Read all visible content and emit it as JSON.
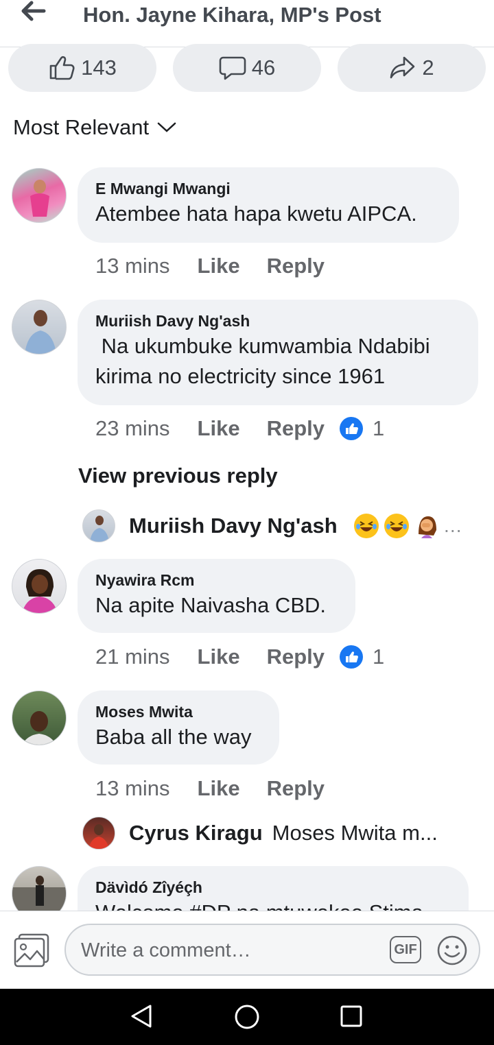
{
  "header": {
    "title": "Hon. Jayne Kihara, MP's Post"
  },
  "stats": {
    "likes": "143",
    "comments": "46",
    "shares": "2"
  },
  "sort": {
    "label": "Most Relevant"
  },
  "comments": [
    {
      "author": "E Mwangi Mwangi",
      "text": "Atembee hata hapa kwetu AIPCA.",
      "time": "13 mins",
      "like": "Like",
      "reply": "Reply",
      "reactions": ""
    },
    {
      "author": "Muriish Davy Ng'ash",
      "text": " Na ukumbuke kumwambia Ndabibi kirima no electricity since 1961",
      "time": "23 mins",
      "like": "Like",
      "reply": "Reply",
      "reactions": "1"
    },
    {
      "author": "Nyawira Rcm",
      "text": "Na apite Naivasha CBD.",
      "time": "21 mins",
      "like": "Like",
      "reply": "Reply",
      "reactions": "1"
    },
    {
      "author": "Moses Mwita",
      "text": "Baba all the way",
      "time": "13 mins",
      "like": "Like",
      "reply": "Reply",
      "reactions": ""
    },
    {
      "author": "Dävìdó Zîyéçh",
      "text": "Welcome #DP na mtuwekee Stima"
    }
  ],
  "view_previous": "View previous reply",
  "reply_previews": [
    {
      "author": "Muriish Davy Ng'ash",
      "text": "…"
    },
    {
      "author": "Cyrus Kiragu",
      "text": "Moses Mwita m..."
    }
  ],
  "composer": {
    "placeholder": "Write a comment…",
    "gif_label": "GIF"
  },
  "colors": {
    "like_blue": "#1877f2",
    "bubble": "#f0f2f5",
    "muted": "#65676b"
  }
}
